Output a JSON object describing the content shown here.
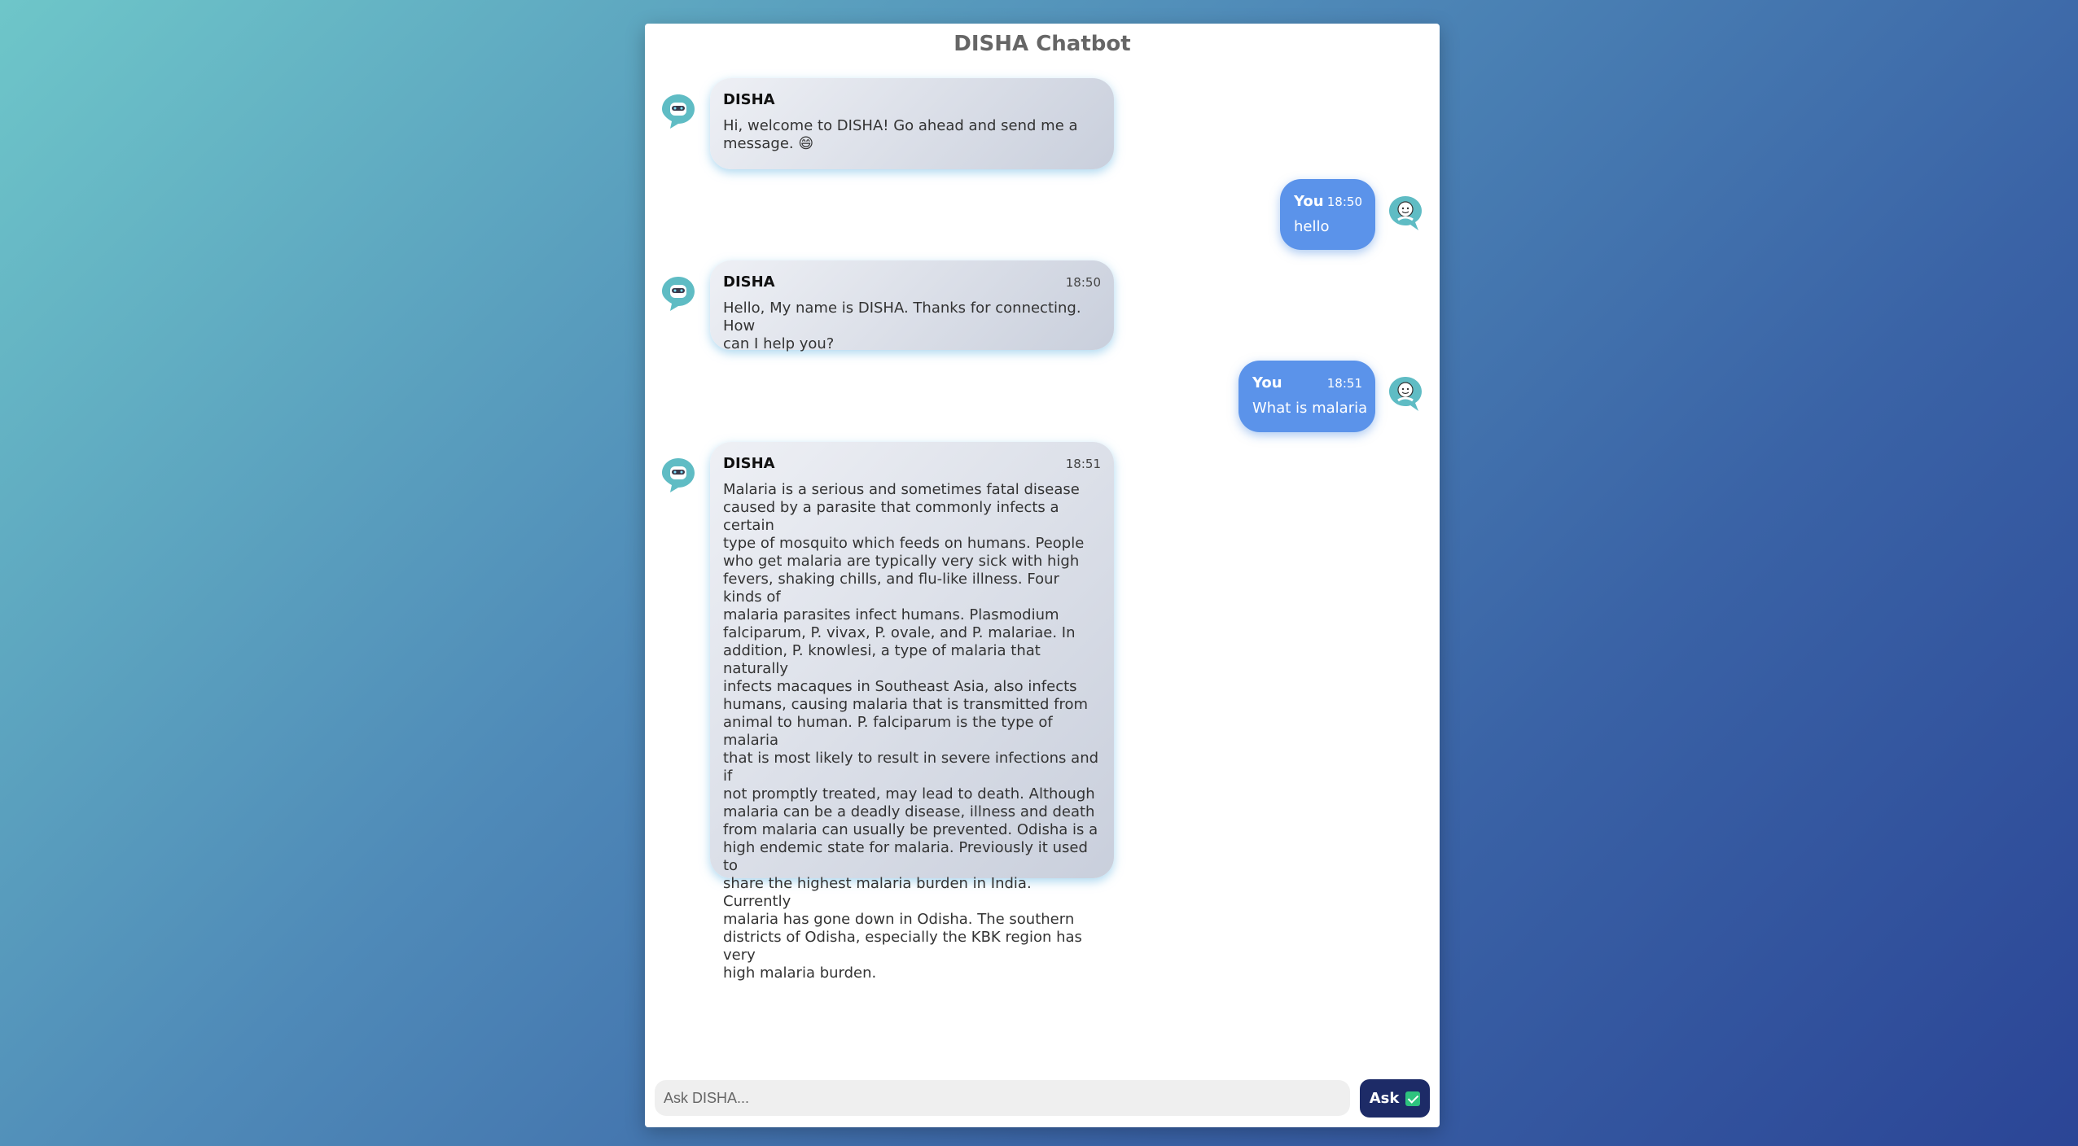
{
  "header": {
    "title": "DISHA Chatbot"
  },
  "messages": [
    {
      "sender": "DISHA",
      "role": "bot",
      "time": "",
      "text": "Hi, welcome to DISHA! Go ahead and send me a\nmessage. 😄"
    },
    {
      "sender": "You",
      "role": "user",
      "time": "18:50",
      "text": "hello"
    },
    {
      "sender": "DISHA",
      "role": "bot",
      "time": "18:50",
      "text": "Hello, My name is DISHA. Thanks for connecting. How\ncan I help you?"
    },
    {
      "sender": "You",
      "role": "user",
      "time": "18:51",
      "text": "What is malaria"
    },
    {
      "sender": "DISHA",
      "role": "bot",
      "time": "18:51",
      "text": "Malaria is a serious and sometimes fatal disease\ncaused by a parasite that commonly infects a certain\ntype of mosquito which feeds on humans. People\nwho get malaria are typically very sick with high\nfevers, shaking chills, and flu-like illness. Four kinds of\nmalaria parasites infect humans. Plasmodium\nfalciparum, P. vivax, P. ovale, and P. malariae. In\naddition, P. knowlesi, a type of malaria that naturally\ninfects macaques in Southeast Asia, also infects\nhumans, causing malaria that is transmitted from\nanimal to human. P. falciparum is the type of malaria\nthat is most likely to result in severe infections and if\nnot promptly treated, may lead to death. Although\nmalaria can be a deadly disease, illness and death\nfrom malaria can usually be prevented. Odisha is a\nhigh endemic state for malaria. Previously it used to\nshare the highest malaria burden in India. Currently\nmalaria has gone down in Odisha. The southern\ndistricts of Odisha, especially the KBK region has very\nhigh malaria burden."
    }
  ],
  "composer": {
    "placeholder": "Ask DISHA...",
    "value": "",
    "button_label": "Ask",
    "button_icon": "check-icon"
  },
  "icons": {
    "bot_avatar": "bot-avatar-icon",
    "user_avatar": "user-avatar-icon"
  },
  "colors": {
    "user_bubble": "#5b93ea",
    "ask_button": "#1d2b67",
    "avatar_teal": "#5fbcc4",
    "check_green": "#2ec27e"
  }
}
